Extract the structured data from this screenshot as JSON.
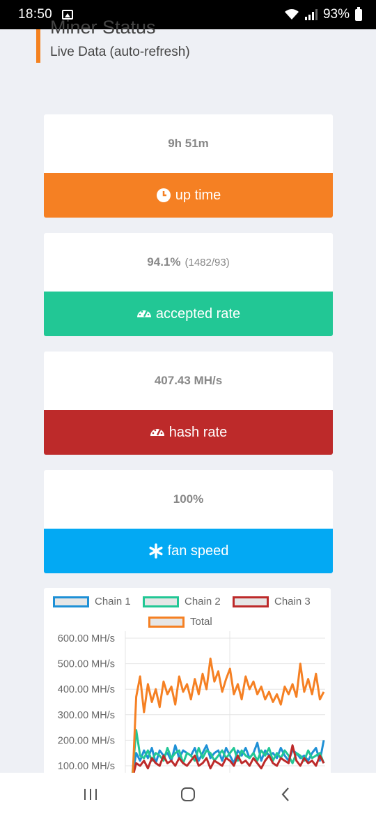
{
  "status_bar": {
    "time": "18:50",
    "battery": "93%"
  },
  "header": {
    "title": "Miner Status",
    "subtitle": "Live Data (auto-refresh)"
  },
  "cards": [
    {
      "value": "9h 51m",
      "sub": "",
      "label": "up time",
      "color": "#f58023",
      "icon": "clock-icon"
    },
    {
      "value": "94.1%",
      "sub": "(1482/93)",
      "label": "accepted rate",
      "color": "#22c795",
      "icon": "gauge-icon"
    },
    {
      "value": "407.43 MH/s",
      "sub": "",
      "label": "hash rate",
      "color": "#bd2a2a",
      "icon": "gauge-icon"
    },
    {
      "value": "100%",
      "sub": "",
      "label": "fan speed",
      "color": "#03a9f3",
      "icon": "asterisk-icon"
    }
  ],
  "chart_data": {
    "type": "line",
    "legend": [
      "Chain 1",
      "Chain 2",
      "Chain 3",
      "Total"
    ],
    "y_tick_labels": [
      "600.00 MH/s",
      "500.00 MH/s",
      "400.00 MH/s",
      "300.00 MH/s",
      "200.00 MH/s",
      "100.00 MH/s"
    ],
    "ylim": [
      0,
      600
    ],
    "series": [
      {
        "name": "Chain 1",
        "color": "#1e90d6",
        "values": [
          60,
          150,
          120,
          160,
          130,
          170,
          110,
          160,
          140,
          150,
          120,
          180,
          130,
          160,
          150,
          140,
          170,
          120,
          150,
          180,
          130,
          150,
          160,
          120,
          170,
          140,
          110,
          160,
          140,
          170,
          130,
          150,
          190,
          120,
          160,
          140,
          150,
          130,
          170,
          140,
          120,
          160,
          150,
          130,
          140,
          120,
          150,
          170,
          120,
          200
        ]
      },
      {
        "name": "Chain 2",
        "color": "#22c795",
        "values": [
          60,
          240,
          140,
          130,
          160,
          120,
          150,
          140,
          120,
          170,
          130,
          150,
          160,
          110,
          150,
          140,
          120,
          170,
          130,
          160,
          150,
          120,
          140,
          160,
          130,
          150,
          170,
          120,
          160,
          140,
          130,
          150,
          120,
          160,
          140,
          170,
          120,
          150,
          130,
          160,
          140,
          110,
          150,
          140,
          120,
          160,
          130,
          140,
          150,
          110
        ]
      },
      {
        "name": "Chain 3",
        "color": "#bd2a2a",
        "values": [
          50,
          110,
          100,
          120,
          90,
          130,
          110,
          100,
          140,
          110,
          120,
          100,
          130,
          110,
          100,
          120,
          140,
          100,
          110,
          130,
          90,
          120,
          110,
          100,
          130,
          120,
          100,
          140,
          110,
          120,
          100,
          130,
          110,
          90,
          120,
          140,
          110,
          100,
          130,
          120,
          110,
          180,
          120,
          100,
          130,
          110,
          120,
          100,
          140,
          110
        ]
      },
      {
        "name": "Total",
        "color": "#f58023",
        "values": [
          20,
          370,
          450,
          310,
          420,
          350,
          400,
          330,
          430,
          380,
          410,
          340,
          450,
          390,
          420,
          360,
          440,
          380,
          460,
          400,
          520,
          430,
          470,
          390,
          440,
          480,
          380,
          420,
          360,
          450,
          400,
          430,
          380,
          410,
          360,
          390,
          350,
          380,
          340,
          410,
          380,
          420,
          370,
          500,
          390,
          440,
          380,
          460,
          360,
          390
        ]
      }
    ]
  }
}
